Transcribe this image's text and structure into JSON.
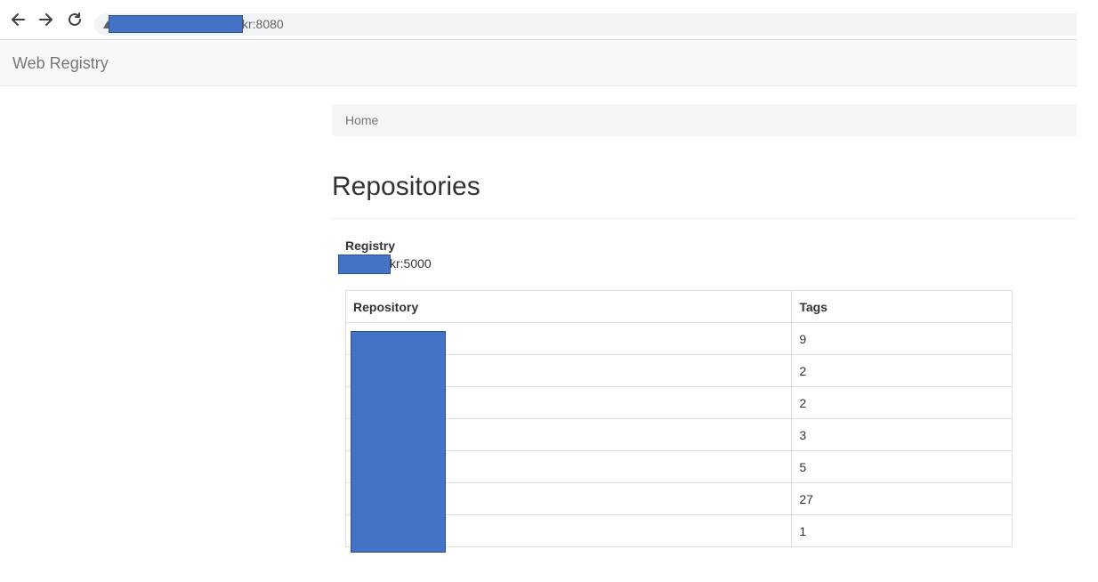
{
  "browser": {
    "url_visible": "kr:8080"
  },
  "navbar": {
    "brand": "Web Registry"
  },
  "breadcrumb": {
    "items": [
      {
        "label": "Home"
      }
    ]
  },
  "page": {
    "title": "Repositories"
  },
  "registry": {
    "label": "Registry",
    "host_visible": "kr:5000"
  },
  "table": {
    "headers": {
      "repository": "Repository",
      "tags": "Tags"
    },
    "rows": [
      {
        "repository": "",
        "tags": "9"
      },
      {
        "repository": "",
        "tags": "2"
      },
      {
        "repository": "",
        "tags": "2"
      },
      {
        "repository": "",
        "tags": "3"
      },
      {
        "repository": "",
        "tags": "5"
      },
      {
        "repository": "",
        "tags": "27"
      },
      {
        "repository": "",
        "tags": "1"
      }
    ]
  },
  "colors": {
    "redaction": "#4472c4",
    "navbar_bg": "#f8f8f8",
    "breadcrumb_bg": "#f5f5f5"
  }
}
